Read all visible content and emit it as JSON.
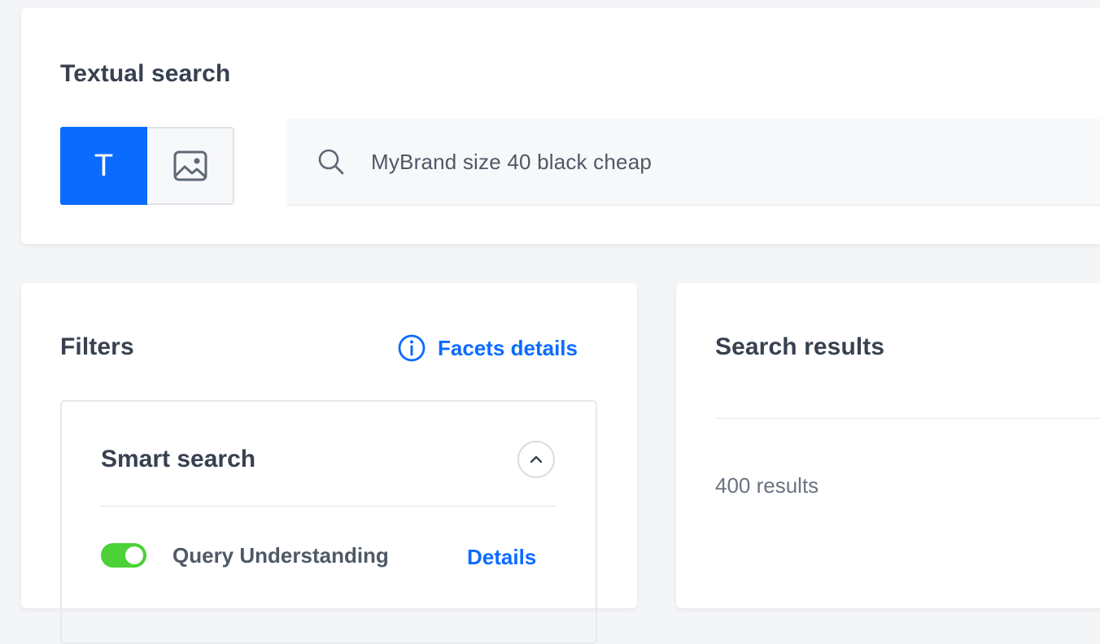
{
  "search": {
    "title": "Textual search",
    "modes": [
      {
        "label": "T",
        "icon": "text-icon",
        "active": true
      },
      {
        "label": "",
        "icon": "image-icon",
        "active": false
      }
    ],
    "icon": "search-icon",
    "value": "MyBrand size 40 black cheap"
  },
  "filters": {
    "title": "Filters",
    "facets_link": {
      "icon": "info-icon",
      "label": "Facets details"
    },
    "smart_search": {
      "title": "Smart search",
      "collapse_icon": "chevron-up-icon",
      "options": [
        {
          "label": "Query Understanding",
          "enabled": true,
          "details_label": "Details"
        }
      ]
    }
  },
  "results": {
    "title": "Search results",
    "count_text": "400 results"
  },
  "colors": {
    "accent": "#0b6bff",
    "toggle_on": "#4cd137",
    "heading": "#384150",
    "muted_text": "#6b7380"
  }
}
